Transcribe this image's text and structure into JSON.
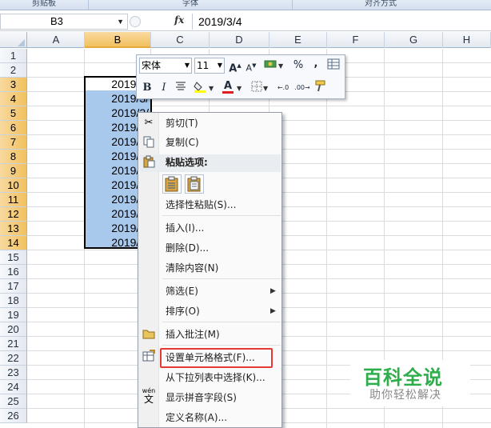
{
  "ribbon": {
    "groups": [
      "剪贴板",
      "字体",
      "对齐方式"
    ]
  },
  "formula_bar": {
    "name_box": "B3",
    "fx_label": "fx",
    "value": "2019/3/4"
  },
  "sheet": {
    "columns": [
      "A",
      "B",
      "C",
      "D",
      "E",
      "F",
      "G",
      "H"
    ],
    "selected_column": "B",
    "rows": [
      "1",
      "2",
      "3",
      "4",
      "5",
      "6",
      "7",
      "8",
      "9",
      "10",
      "11",
      "12",
      "13",
      "14",
      "15",
      "16",
      "17",
      "18",
      "19",
      "20",
      "21",
      "22",
      "23",
      "24",
      "25",
      "26"
    ],
    "selected_rows": [
      "3",
      "4",
      "5",
      "6",
      "7",
      "8",
      "9",
      "10",
      "11",
      "12",
      "13",
      "14"
    ],
    "cells": [
      "2019/3/",
      "2019/3/",
      "2019/3/",
      "2019/3/",
      "2019/3/",
      "2019/3/",
      "2019/3/",
      "2019/3/",
      "2019/3/",
      "2019/3/",
      "2019/3/",
      "2019/3/"
    ]
  },
  "mini_toolbar": {
    "font": "宋体",
    "size": "11",
    "grow_font": "A",
    "shrink_font": "A",
    "percent": "%",
    "comma": ",",
    "bold": "B",
    "italic": "I",
    "font_color_letter": "A",
    "increase_decimal": "←.0",
    "decrease_decimal": ".00→"
  },
  "context_menu": {
    "items": {
      "cut": "剪切(T)",
      "copy": "复制(C)",
      "paste_options": "粘贴选项:",
      "paste_special": "选择性粘贴(S)...",
      "insert": "插入(I)...",
      "delete": "删除(D)...",
      "clear": "清除内容(N)",
      "filter": "筛选(E)",
      "sort": "排序(O)",
      "insert_comment": "插入批注(M)",
      "format_cells": "设置单元格格式(F)...",
      "pick_from_list": "从下拉列表中选择(K)...",
      "phonetic": "显示拼音字段(S)",
      "define_name": "定义名称(A)..."
    },
    "phonetic_icon_text": "wén",
    "phonetic_icon_char": "文",
    "highlight_color": "#e53935"
  },
  "watermark": {
    "title": "百科全说",
    "subtitle": "助你轻松解决"
  }
}
